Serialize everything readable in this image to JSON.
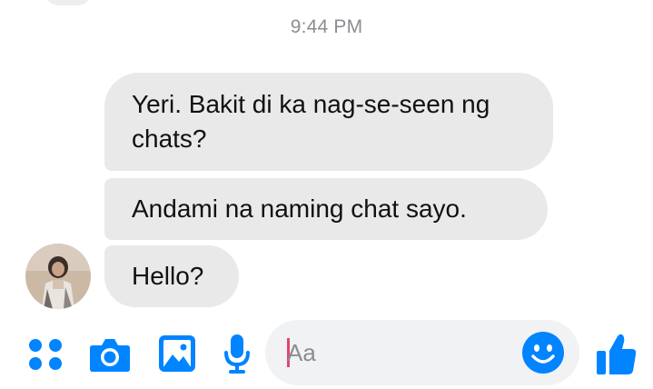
{
  "conversation": {
    "timestamp": "9:44 PM",
    "messages": [
      {
        "text": "Yeri. Bakit di ka nag-se-seen ng chats?"
      },
      {
        "text": "Andami na naming chat sayo."
      },
      {
        "text": "Hello?"
      }
    ]
  },
  "composer": {
    "placeholder": "Aa",
    "value": ""
  },
  "toolbar": {
    "icons": [
      "more-apps-icon",
      "camera-icon",
      "gallery-icon",
      "microphone-icon",
      "emoji-icon",
      "like-icon"
    ]
  },
  "colors": {
    "accent": "#0084ff",
    "bubble_background": "#e9e9ea",
    "composer_background": "#f1f2f4",
    "caret": "#e5436f",
    "timestamp_text": "#8a8d91"
  }
}
